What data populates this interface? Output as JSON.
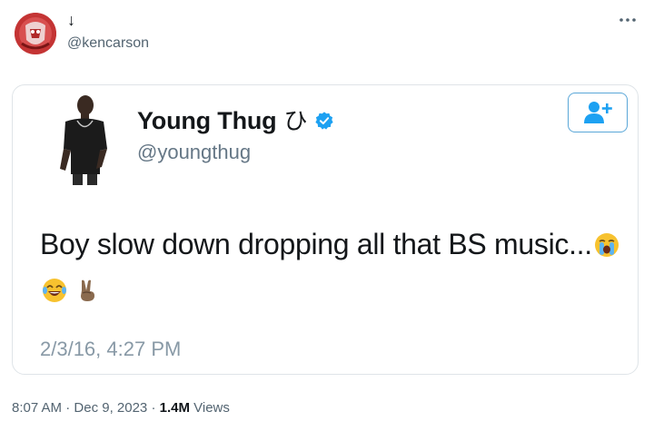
{
  "post": {
    "author_name": "↓",
    "author_handle": "@kencarson",
    "avatar_icon": "red-stamp-avatar",
    "more_icon": "more-dots-icon"
  },
  "quoted": {
    "name": "Young Thug",
    "name_glyph": "ひ",
    "handle": "@youngthug",
    "text": "Boy slow down dropping all that BS music...",
    "emoji": [
      "loudly-crying-face",
      "tears-of-joy-face",
      "victory-hand"
    ],
    "timestamp": "2/3/16, 4:27 PM",
    "follow_icon": "add-user-icon",
    "verified_icon": "verified-badge-icon",
    "accent_color": "#1da1f2"
  },
  "meta": {
    "time": "8:07 AM",
    "sep1": " · ",
    "date": "Dec 9, 2023",
    "sep2": " · ",
    "views_count": "1.4M",
    "views_label": " Views"
  }
}
